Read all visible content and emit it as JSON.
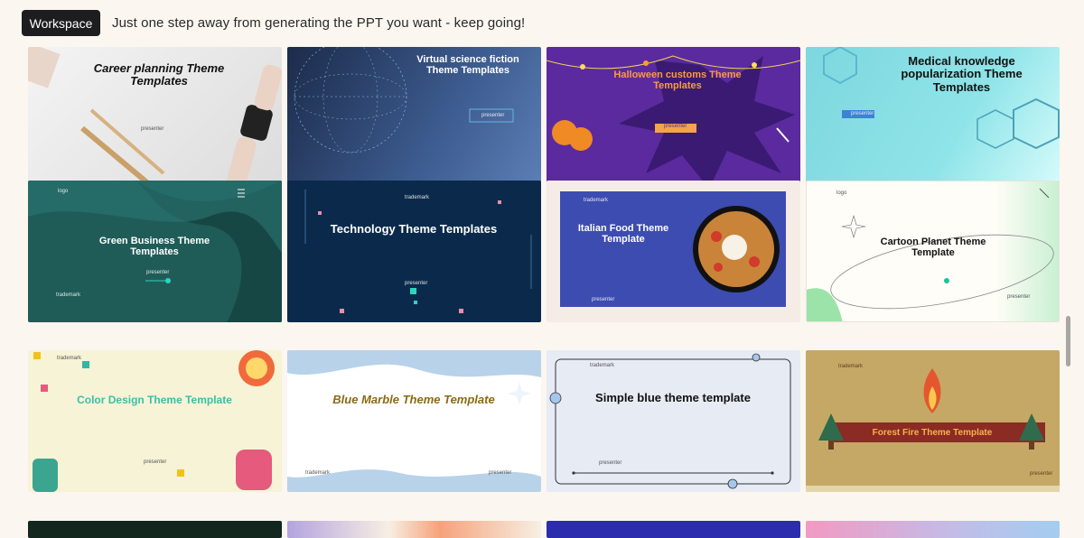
{
  "header": {
    "workspace_label": "Workspace",
    "hint_text": "Just one step away from generating the PPT you want - keep going!"
  },
  "templates": [
    {
      "title": "Career planning Theme Templates",
      "label": "presenter"
    },
    {
      "title": "Virtual science fiction Theme Templates",
      "label": "presenter"
    },
    {
      "title": "Halloween customs Theme Templates",
      "label": "presenter"
    },
    {
      "title": "Medical knowledge popularization Theme Templates",
      "label": "presenter"
    },
    {
      "title": "Green Business Theme Templates",
      "logo": "logo",
      "label": "presenter",
      "trademark": "trademark"
    },
    {
      "title": "Technology Theme Templates",
      "trademark": "trademark",
      "label": "presenter"
    },
    {
      "title": "Italian Food Theme Template",
      "trademark": "trademark",
      "label": "presenter"
    },
    {
      "title": "Cartoon Planet Theme Template",
      "logo": "logo",
      "label": "presenter"
    },
    {
      "title": "Color Design Theme Template",
      "trademark": "trademark",
      "label": "presenter"
    },
    {
      "title": "Blue Marble Theme Template",
      "trademark": "trademark",
      "label": "presenter"
    },
    {
      "title": "Simple blue theme template",
      "trademark": "trademark",
      "label": "presenter"
    },
    {
      "title": "Forest Fire Theme Template",
      "trademark": "trademark",
      "label": "presenter"
    }
  ],
  "colors": {
    "page_bg": "#fbf6f0",
    "button_bg": "#1d1d1f"
  }
}
